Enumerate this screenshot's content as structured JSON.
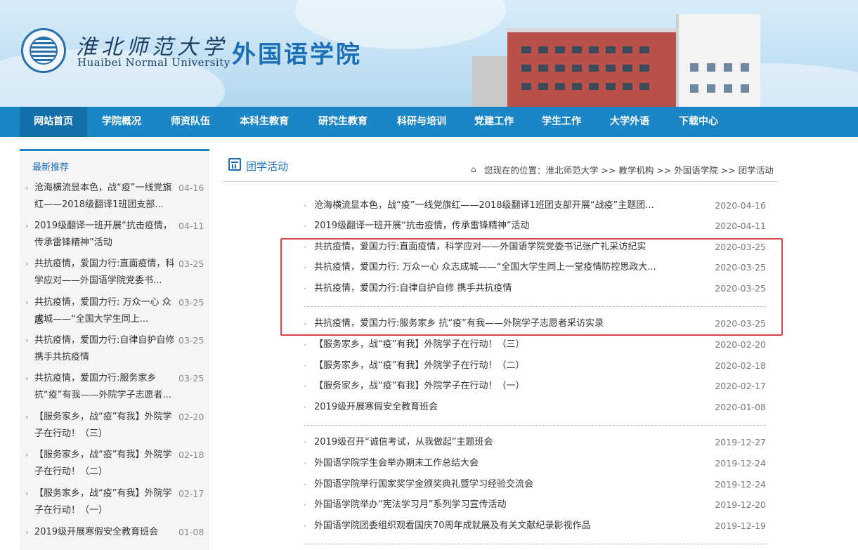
{
  "header": {
    "university_cn": "淮北师范大学",
    "university_en": "Huaibei Normal University",
    "college": "外国语学院"
  },
  "nav": {
    "items": [
      {
        "label": "网站首页",
        "active": true
      },
      {
        "label": "学院概况"
      },
      {
        "label": "师资队伍"
      },
      {
        "label": "本科生教育"
      },
      {
        "label": "研究生教育"
      },
      {
        "label": "科研与培训"
      },
      {
        "label": "党建工作"
      },
      {
        "label": "学生工作"
      },
      {
        "label": "大学外语"
      },
      {
        "label": "下载中心"
      }
    ]
  },
  "sidebar": {
    "title": "最新推荐",
    "items": [
      {
        "line1": "沧海横流显本色，战“疫”一线党旗",
        "line2": "红——2018级翻译1班团支部...",
        "date": "04-16"
      },
      {
        "line1": "2019级翻译一班开展“抗击疫情，",
        "line2": "传承雷锋精神”活动",
        "date": "04-11"
      },
      {
        "line1": "共抗疫情，爱国力行:直面疫情，科",
        "line2": "学应对——外国语学院党委书...",
        "date": "03-25"
      },
      {
        "line1": "共抗疫情，爱国力行: 万众一心 众志",
        "line2": "成城——“全国大学生同上...",
        "date": "03-25"
      },
      {
        "line1": "共抗疫情，爱国力行:自律自护自修",
        "line2": "携手共抗疫情",
        "date": "03-25"
      },
      {
        "line1": "共抗疫情，爱国力行:服务家乡",
        "line2": "抗“疫”有我——外院学子志愿者...",
        "date": "03-25"
      },
      {
        "line1": "【服务家乡，战“疫”有我】外院学",
        "line2": "子在行动！（三）",
        "date": "02-20"
      },
      {
        "line1": "【服务家乡，战“疫”有我】外院学",
        "line2": "子在行动！（二）",
        "date": "02-18"
      },
      {
        "line1": "【服务家乡，战“疫”有我】外院学",
        "line2": "子在行动！（一）",
        "date": "02-17"
      },
      {
        "line1": "2019级开展寒假安全教育班会",
        "line2": "",
        "date": "01-08"
      }
    ]
  },
  "main": {
    "title": "团学活动",
    "breadcrumb": "您现在的位置：淮北师范大学 >> 教学机构 >> 外国语学院 >> 团学活动",
    "articles": [
      {
        "title": "沧海横流显本色，战“疫”一线党旗红——2018级翻译1班团支部开展“战疫”主题团...",
        "date": "2020-04-16"
      },
      {
        "title": "2019级翻译一班开展“抗击疫情，传承雷锋精神”活动",
        "date": "2020-04-11"
      },
      {
        "title": "共抗疫情，爱国力行:直面疫情，科学应对——外国语学院党委书记张广礼采访纪实",
        "date": "2020-03-25"
      },
      {
        "title": "共抗疫情，爱国力行: 万众一心 众志成城——“全国大学生同上一堂疫情防控思政大...",
        "date": "2020-03-25"
      },
      {
        "title": "共抗疫情，爱国力行:自律自护自修 携手共抗疫情",
        "date": "2020-03-25"
      },
      {
        "title": "共抗疫情，爱国力行:服务家乡 抗“疫”有我——外院学子志愿者采访实录",
        "date": "2020-03-25"
      },
      {
        "title": "【服务家乡，战“疫”有我】外院学子在行动！（三）",
        "date": "2020-02-20"
      },
      {
        "title": "【服务家乡，战“疫”有我】外院学子在行动！（二）",
        "date": "2020-02-18"
      },
      {
        "title": "【服务家乡，战“疫”有我】外院学子在行动！（一）",
        "date": "2020-02-17"
      },
      {
        "title": "2019级开展寒假安全教育班会",
        "date": "2020-01-08"
      },
      {
        "title": "2019级召开“诚信考试，从我做起”主题班会",
        "date": "2019-12-27"
      },
      {
        "title": "外国语学院学生会举办期末工作总结大会",
        "date": "2019-12-24"
      },
      {
        "title": "外国语学院举行国家奖学金颁奖典礼暨学习经验交流会",
        "date": "2019-12-24"
      },
      {
        "title": "外国语学院举办“宪法学习月”系列学习宣传活动",
        "date": "2019-12-20"
      },
      {
        "title": "外国语学院团委组织观看国庆70周年成就展及有关文献纪录影视作品",
        "date": "2019-12-19"
      }
    ]
  },
  "colors": {
    "nav": "#1a86c5",
    "nav_active": "#156fa8",
    "accent": "#1b6fb8",
    "highlight": "#d9464a"
  }
}
